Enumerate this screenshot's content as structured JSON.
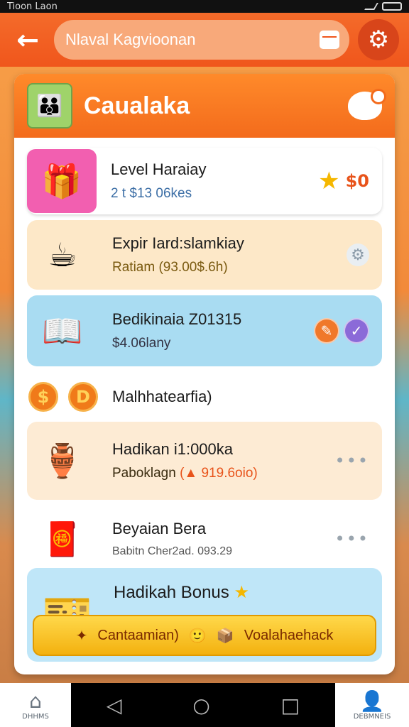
{
  "status_bar": {
    "left_text": "Tioon Laon"
  },
  "topbar": {
    "search_text": "Nlaval Kagvioonan"
  },
  "card": {
    "title": "Caualaka"
  },
  "rows": [
    {
      "title": "Level Haraiay",
      "sub": "2 t  $13 06kes",
      "price": "$0"
    },
    {
      "title": "Expir Iard:slamkiay",
      "sub": "Ratiam (93.00$.6h)"
    },
    {
      "title": "Bedikinaia Z01315",
      "sub": "$4.06lany"
    },
    {
      "title": "Malhhatearfia)"
    },
    {
      "title": "Hadikan i1:000ka",
      "sub_prefix": "Paboklagn",
      "sub_highlight": "(▲ 919.6oio)"
    },
    {
      "title": "Beyaian Bera",
      "sub": "Babitn Cher2ad. 093.29"
    }
  ],
  "bonus": {
    "title": "Hadikah Bonus",
    "bar_left": "Cantaamian)",
    "bar_right": "Voalahaehack"
  },
  "nav": {
    "left_label": "DHHMS",
    "right_label": "DEBMNEIS"
  },
  "colors": {
    "accent": "#f0561c",
    "header_orange": "#f36b1c",
    "gold": "#f5b700"
  }
}
